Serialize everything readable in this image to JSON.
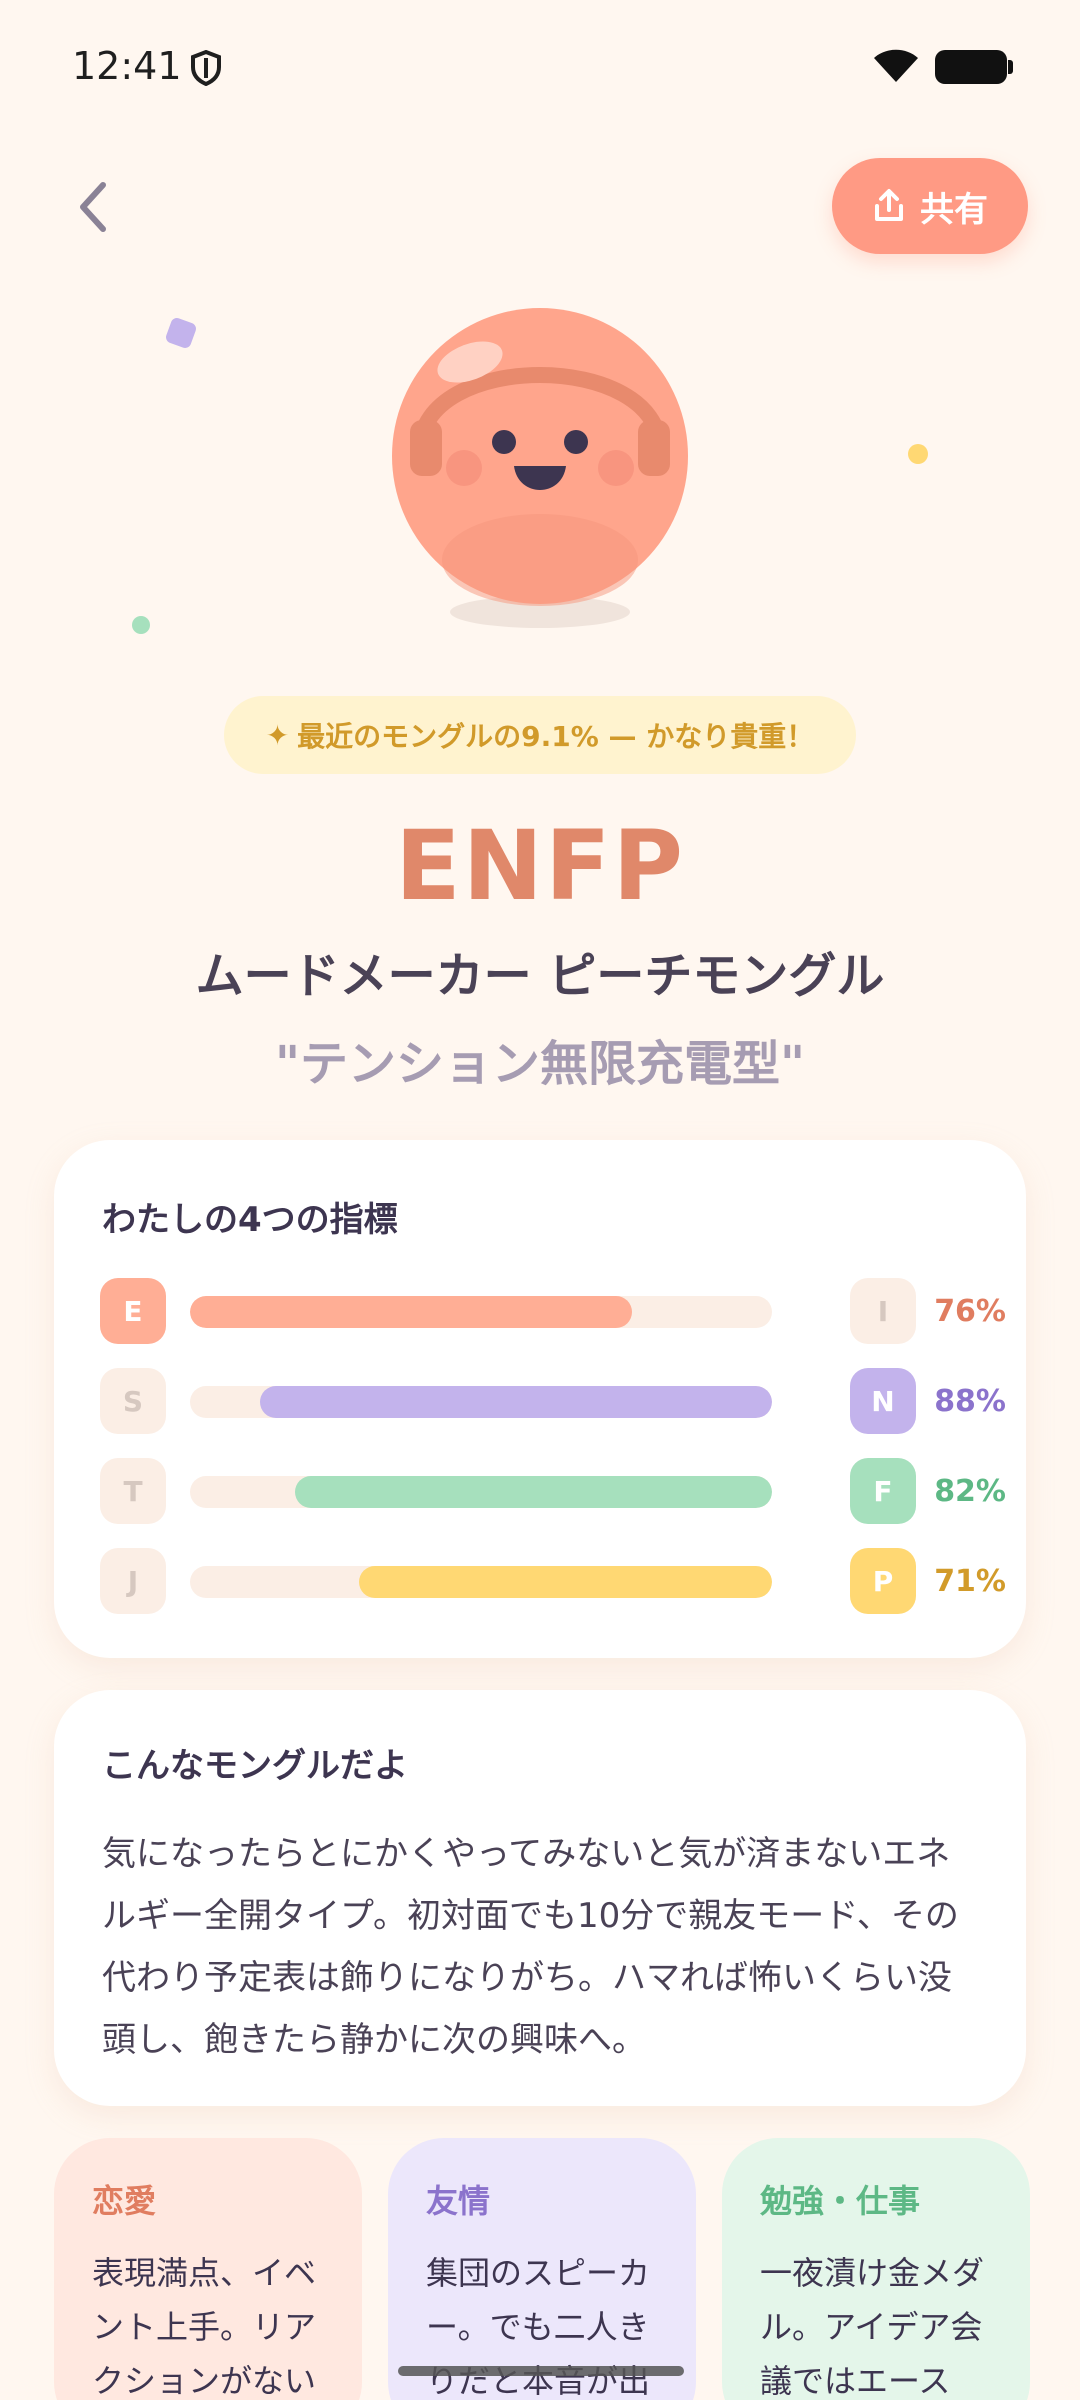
{
  "status_bar": {
    "time": "12:41"
  },
  "header": {
    "share_label": "共有"
  },
  "rarity_badge": "最近のモングルの9.1% — かなり貴重！",
  "result": {
    "type_code": "ENFP",
    "type_name": "ムードメーカー ピーチモングル",
    "tagline": "\"テンション無限充電型\""
  },
  "indicators": {
    "title": "わたしの4つの指標",
    "rows": [
      {
        "left": "E",
        "right": "I",
        "percent": "76%",
        "value": 0.76,
        "direction": "left",
        "color": "#ffae95",
        "text_color": "#e07d60"
      },
      {
        "left": "S",
        "right": "N",
        "percent": "88%",
        "value": 0.88,
        "direction": "right",
        "color": "#c3b3ec",
        "text_color": "#8b73cc"
      },
      {
        "left": "T",
        "right": "F",
        "percent": "82%",
        "value": 0.82,
        "direction": "right",
        "color": "#a6e0bd",
        "text_color": "#5db885"
      },
      {
        "left": "J",
        "right": "P",
        "percent": "71%",
        "value": 0.71,
        "direction": "right",
        "color": "#ffd873",
        "text_color": "#d29b2a"
      }
    ]
  },
  "description": {
    "title": "こんなモングルだよ",
    "lines": [
      "気になったらとにかくやってみないと気が済まないエネ",
      "ルギー全開タイプ。初対面でも10分で親友モード、その",
      "代わり予定表は飾りになりがち。ハマれば怖いくらい没",
      "頭し、飽きたら静かに次の興味へ。"
    ]
  },
  "categories": [
    {
      "title": "恋愛",
      "lines": [
        "表現満点、イベ",
        "ント上手。リア",
        "クションがない"
      ],
      "bg": "#ffe8e0",
      "title_color": "#e07d60"
    },
    {
      "title": "友情",
      "lines": [
        "集団のスピーカ",
        "ー。でも二人き",
        "りだと本音が出"
      ],
      "bg": "#ece7fb",
      "title_color": "#8b73cc"
    },
    {
      "title": "勉強・仕事",
      "lines": [
        "一夜漬け金メダ",
        "ル。アイデア会",
        "議ではエース"
      ],
      "bg": "#e4f6ea",
      "title_color": "#5db885"
    }
  ],
  "icons": [
    "shield-icon",
    "wifi-icon",
    "battery-icon",
    "back-chevron-icon",
    "share-icon",
    "sparkle-icon"
  ]
}
